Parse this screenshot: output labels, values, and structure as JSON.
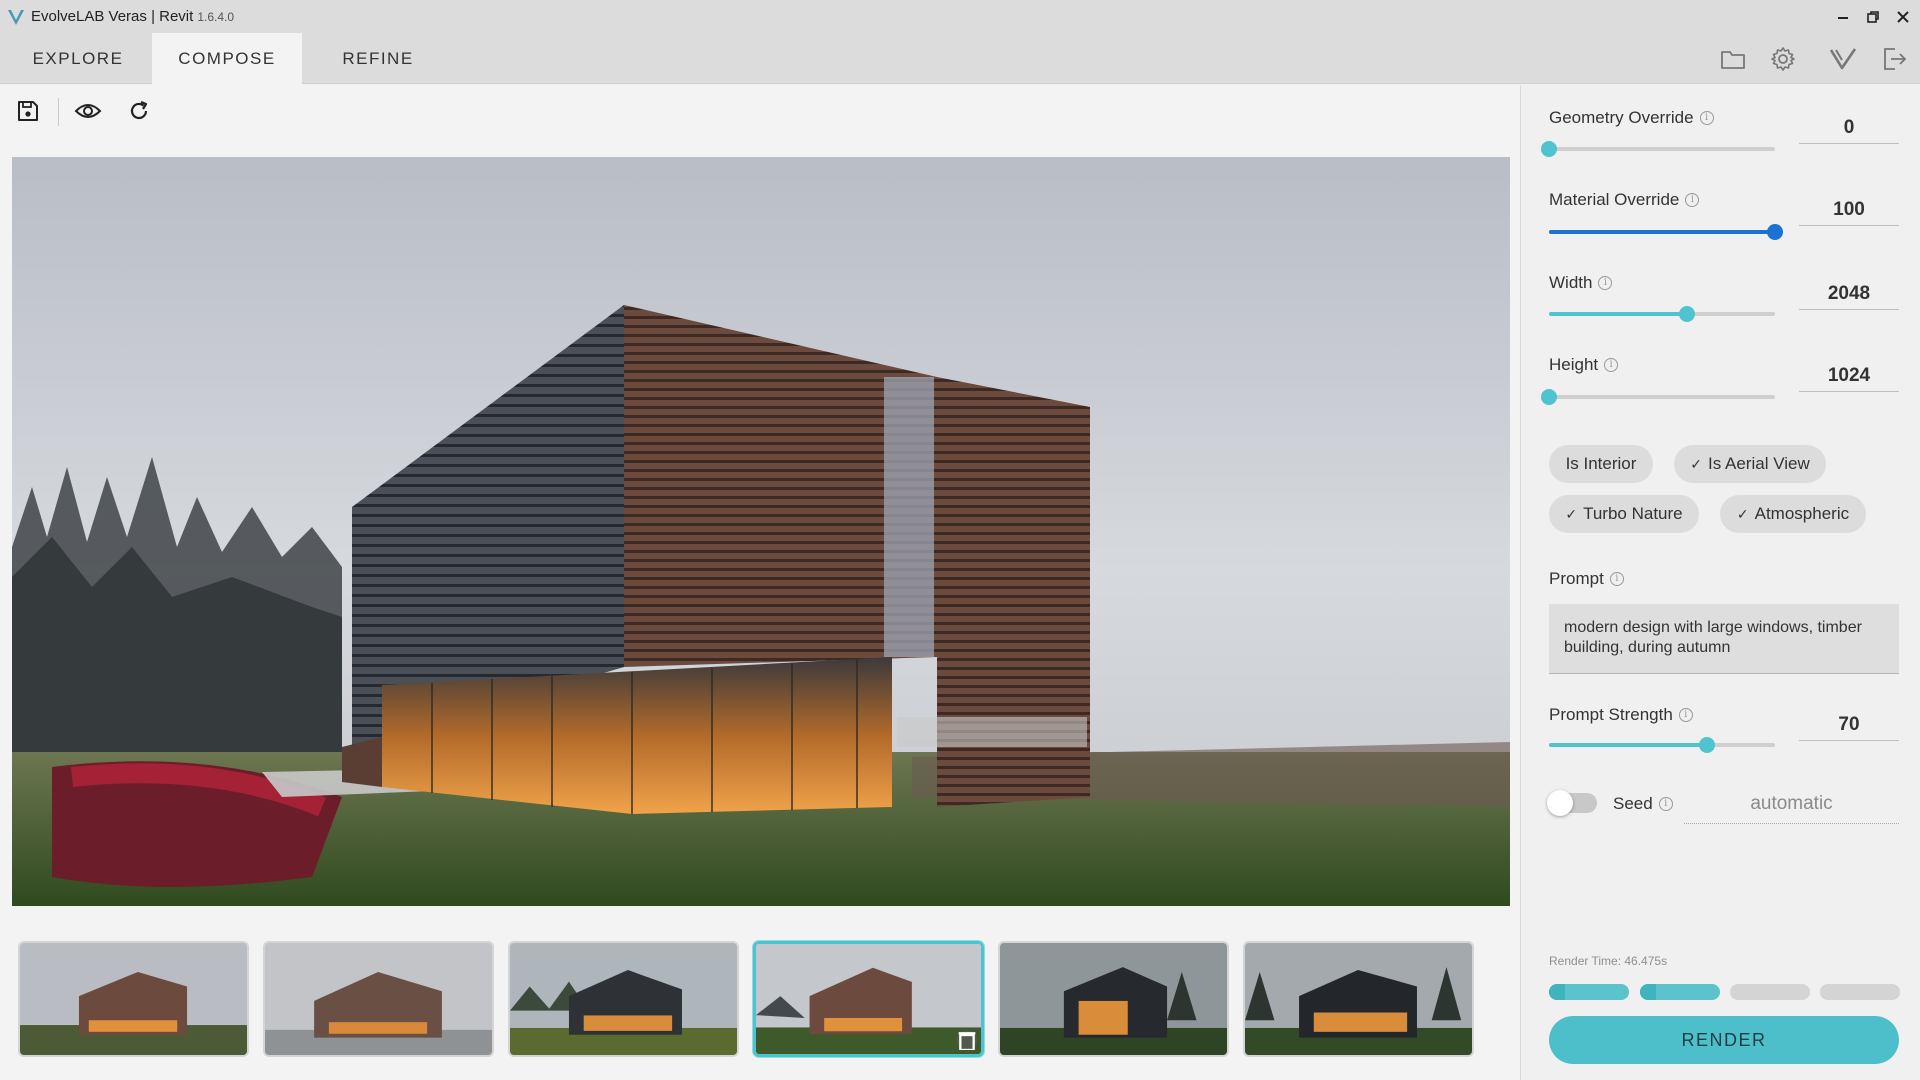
{
  "app": {
    "title": "EvolveLAB Veras | Revit",
    "version": "1.6.4.0"
  },
  "window_controls": [
    "minimize-icon",
    "restore-icon",
    "close-icon"
  ],
  "tabs": [
    {
      "label": "EXPLORE",
      "active": false
    },
    {
      "label": "COMPOSE",
      "active": true
    },
    {
      "label": "REFINE",
      "active": false
    }
  ],
  "top_icons": [
    "folder-icon",
    "gear-icon",
    "veras-logo-icon",
    "logout-icon"
  ],
  "toolbar": [
    "save-icon",
    "eye-icon",
    "refresh-icon"
  ],
  "thumbnails": {
    "count": 6,
    "selected_index": 3
  },
  "settings": {
    "geometry_override": {
      "label": "Geometry Override",
      "value": "0",
      "fraction": 0.0
    },
    "material_override": {
      "label": "Material Override",
      "value": "100",
      "fraction": 1.0
    },
    "width": {
      "label": "Width",
      "value": "2048",
      "fraction": 0.61
    },
    "height": {
      "label": "Height",
      "value": "1024",
      "fraction": 0.0
    },
    "options": [
      {
        "label": "Is Interior",
        "checked": false
      },
      {
        "label": "Is Aerial View",
        "checked": true
      },
      {
        "label": "Turbo Nature",
        "checked": true
      },
      {
        "label": "Atmospheric",
        "checked": true
      }
    ],
    "prompt": {
      "label": "Prompt",
      "text": "modern design with large windows, timber building, during autumn"
    },
    "prompt_strength": {
      "label": "Prompt Strength",
      "value": "70",
      "fraction": 0.7
    },
    "seed": {
      "label": "Seed",
      "enabled": false,
      "value": "automatic"
    }
  },
  "render": {
    "time_text": "Render Time: 46.475s",
    "progress_segments": [
      1.0,
      1.0,
      0.0,
      0.0
    ],
    "button_label": "RENDER"
  },
  "colors": {
    "accent": "#4dbfca",
    "slider_blue": "#1a73d4",
    "tab_bar": "#dcdcdc"
  }
}
